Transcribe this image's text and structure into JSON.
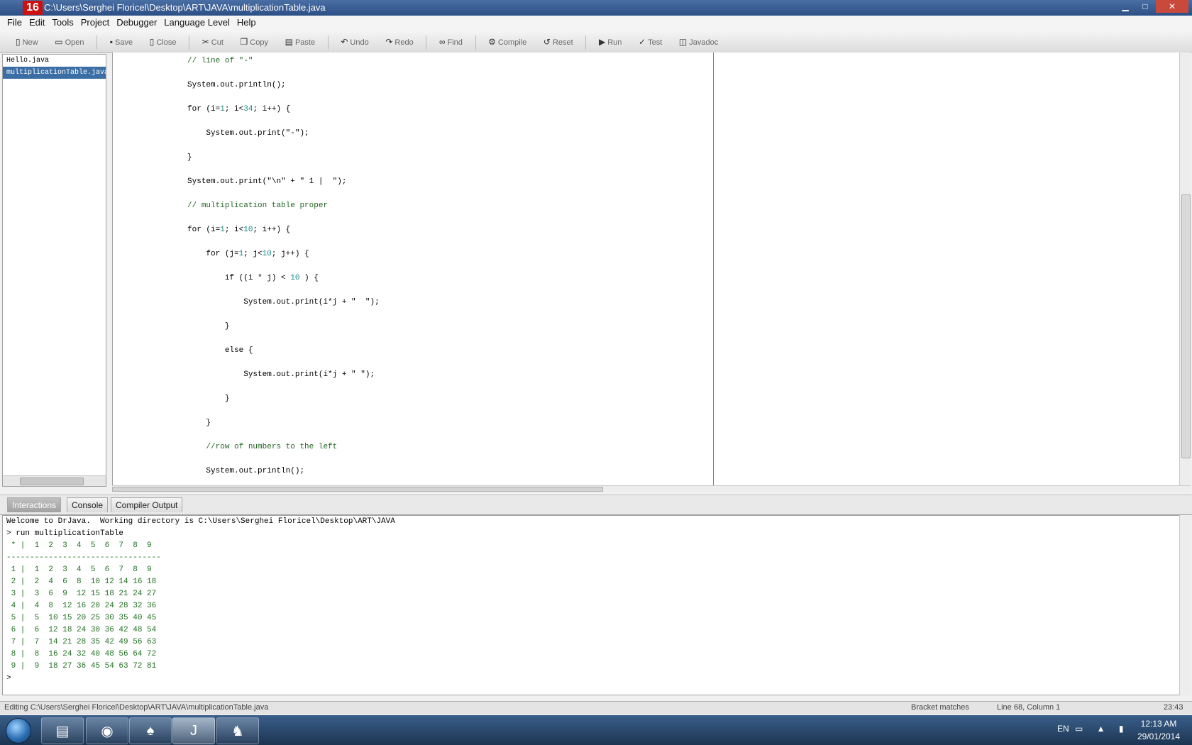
{
  "window": {
    "logo": "16",
    "title": "C:\\Users\\Serghei Floricel\\Desktop\\ART\\JAVA\\multiplicationTable.java",
    "minimize": "▁",
    "maximize": "□",
    "close": "✕"
  },
  "menu": [
    "File",
    "Edit",
    "Tools",
    "Project",
    "Debugger",
    "Language Level",
    "Help"
  ],
  "toolbar": [
    {
      "label": "New",
      "icon": "new-file-icon"
    },
    {
      "label": "Open",
      "icon": "open-icon"
    },
    {
      "label": "Save",
      "icon": "save-icon"
    },
    {
      "label": "Close",
      "icon": "close-doc-icon"
    },
    {
      "label": "Cut",
      "icon": "scissors-icon"
    },
    {
      "label": "Copy",
      "icon": "copy-icon"
    },
    {
      "label": "Paste",
      "icon": "paste-icon"
    },
    {
      "label": "Undo",
      "icon": "undo-icon"
    },
    {
      "label": "Redo",
      "icon": "redo-icon"
    },
    {
      "label": "Find",
      "icon": "binoculars-icon"
    },
    {
      "label": "Compile",
      "icon": "compile-icon"
    },
    {
      "label": "Reset",
      "icon": "reset-icon"
    },
    {
      "label": "Run",
      "icon": "run-icon"
    },
    {
      "label": "Test",
      "icon": "test-icon"
    },
    {
      "label": "Javadoc",
      "icon": "javadoc-icon"
    }
  ],
  "documents": [
    {
      "name": "Hello.java",
      "active": false
    },
    {
      "name": "multiplicationTable.java",
      "active": true
    }
  ],
  "code_lines": [
    {
      "indent": "        ",
      "parts": [
        {
          "t": "// line of \"-\"",
          "c": "com"
        }
      ]
    },
    {
      "indent": "        ",
      "parts": [
        {
          "t": "System.out.println();",
          "c": ""
        }
      ]
    },
    {
      "indent": "        ",
      "parts": [
        {
          "t": "for (i=",
          "c": ""
        },
        {
          "t": "1",
          "c": "num"
        },
        {
          "t": "; i<",
          "c": ""
        },
        {
          "t": "34",
          "c": "num"
        },
        {
          "t": "; i++) {",
          "c": ""
        }
      ]
    },
    {
      "indent": "            ",
      "parts": [
        {
          "t": "System.out.print(\"-\");",
          "c": ""
        }
      ]
    },
    {
      "indent": "        ",
      "parts": [
        {
          "t": "}",
          "c": ""
        }
      ]
    },
    {
      "indent": "        ",
      "parts": [
        {
          "t": "System.out.print(\"\\n\" + \" 1 |  \");",
          "c": ""
        }
      ]
    },
    {
      "indent": "        ",
      "parts": [
        {
          "t": "// multiplication table proper",
          "c": "com"
        }
      ]
    },
    {
      "indent": "        ",
      "parts": [
        {
          "t": "for (i=",
          "c": ""
        },
        {
          "t": "1",
          "c": "num"
        },
        {
          "t": "; i<",
          "c": ""
        },
        {
          "t": "10",
          "c": "num"
        },
        {
          "t": "; i++) {",
          "c": ""
        }
      ]
    },
    {
      "indent": "            ",
      "parts": [
        {
          "t": "for (j=",
          "c": ""
        },
        {
          "t": "1",
          "c": "num"
        },
        {
          "t": "; j<",
          "c": ""
        },
        {
          "t": "10",
          "c": "num"
        },
        {
          "t": "; j++) {",
          "c": ""
        }
      ]
    },
    {
      "indent": "                ",
      "parts": [
        {
          "t": "if ((i * j) < ",
          "c": ""
        },
        {
          "t": "10",
          "c": "num"
        },
        {
          "t": " ) {",
          "c": ""
        }
      ]
    },
    {
      "indent": "                    ",
      "parts": [
        {
          "t": "System.out.print(i*j + \"  \");",
          "c": ""
        }
      ]
    },
    {
      "indent": "                ",
      "parts": [
        {
          "t": "}",
          "c": ""
        }
      ]
    },
    {
      "indent": "                ",
      "parts": [
        {
          "t": "else {",
          "c": ""
        }
      ]
    },
    {
      "indent": "                    ",
      "parts": [
        {
          "t": "System.out.print(i*j + \" \");",
          "c": ""
        }
      ]
    },
    {
      "indent": "                ",
      "parts": [
        {
          "t": "}",
          "c": ""
        }
      ]
    },
    {
      "indent": "            ",
      "parts": [
        {
          "t": "}",
          "c": ""
        }
      ]
    },
    {
      "indent": "            ",
      "parts": [
        {
          "t": "//row of numbers to the left",
          "c": "com"
        }
      ]
    },
    {
      "indent": "            ",
      "parts": [
        {
          "t": "System.out.println();",
          "c": ""
        }
      ]
    }
  ],
  "tabs": [
    "Interactions",
    "Console",
    "Compiler Output"
  ],
  "interactions": [
    {
      "text": "Welcome to DrJava.  Working directory is C:\\Users\\Serghei Floricel\\Desktop\\ART\\JAVA",
      "kind": "plain"
    },
    {
      "text": "> run multiplicationTable",
      "kind": "plain"
    },
    {
      "text": " * |  1  2  3  4  5  6  7  8  9",
      "kind": "output"
    },
    {
      "text": "---------------------------------",
      "kind": "output"
    },
    {
      "text": " 1 |  1  2  3  4  5  6  7  8  9",
      "kind": "output"
    },
    {
      "text": " 2 |  2  4  6  8  10 12 14 16 18",
      "kind": "output"
    },
    {
      "text": " 3 |  3  6  9  12 15 18 21 24 27",
      "kind": "output"
    },
    {
      "text": " 4 |  4  8  12 16 20 24 28 32 36",
      "kind": "output"
    },
    {
      "text": " 5 |  5  10 15 20 25 30 35 40 45",
      "kind": "output"
    },
    {
      "text": " 6 |  6  12 18 24 30 36 42 48 54",
      "kind": "output"
    },
    {
      "text": " 7 |  7  14 21 28 35 42 49 56 63",
      "kind": "output"
    },
    {
      "text": " 8 |  8  16 24 32 40 48 56 64 72",
      "kind": "output"
    },
    {
      "text": " 9 |  9  18 27 36 45 54 63 72 81",
      "kind": "output"
    },
    {
      "text": ">",
      "kind": "plain"
    }
  ],
  "status": {
    "file": "Editing C:\\Users\\Serghei Floricel\\Desktop\\ART\\JAVA\\multiplicationTable.java",
    "bracket": "Bracket matches",
    "position": "Line 68, Column 1",
    "right": "23:43"
  },
  "taskbar": {
    "apps": [
      {
        "name": "explorer",
        "glyph": "▤"
      },
      {
        "name": "chrome",
        "glyph": "◉"
      },
      {
        "name": "pdf-reader",
        "glyph": "♠"
      },
      {
        "name": "drjava",
        "glyph": "J"
      },
      {
        "name": "game",
        "glyph": "♞"
      }
    ],
    "language": "EN",
    "tray": "▭ ▲ ▮",
    "time": "12:13 AM",
    "date": "29/01/2014"
  },
  "colors": {
    "selection": "#3a6ea5",
    "comment": "#226622",
    "number": "#1a8a8a",
    "output": "#1f6f1f"
  }
}
